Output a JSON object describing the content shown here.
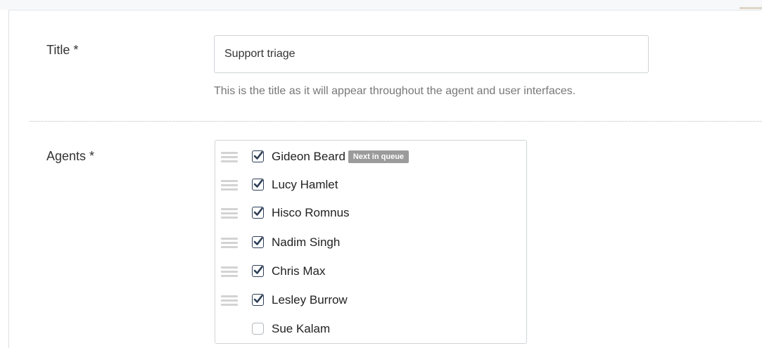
{
  "form": {
    "title_field": {
      "label": "Title *",
      "value": "Support triage",
      "help": "This is the title as it will appear throughout the agent and user interfaces."
    },
    "agents_field": {
      "label": "Agents *",
      "items": [
        {
          "name": "Gideon Beard",
          "checked": true,
          "badge": "Next in queue"
        },
        {
          "name": "Lucy Hamlet",
          "checked": true
        },
        {
          "name": "Hisco Romnus",
          "checked": true
        },
        {
          "name": "Nadim Singh",
          "checked": true
        },
        {
          "name": "Chris Max",
          "checked": true
        },
        {
          "name": "Lesley Burrow",
          "checked": true
        },
        {
          "name": "Sue Kalam",
          "checked": false
        }
      ]
    }
  },
  "icons": {
    "drag_handle": "drag-handle-icon",
    "checked": "checkmark-icon"
  },
  "colors": {
    "checkbox_border": "#2d3e57",
    "badge_background": "#9b9b9b",
    "help_text": "#777777"
  }
}
